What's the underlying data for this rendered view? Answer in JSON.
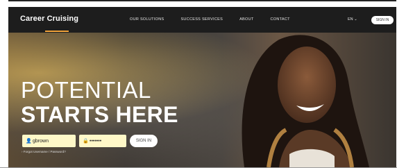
{
  "brand": {
    "name": "Career Cruising"
  },
  "nav": {
    "links": [
      "OUR SOLUTIONS",
      "SUCCESS SERVICES",
      "ABOUT",
      "CONTACT"
    ],
    "language": "EN",
    "signin_label": "SIGN IN"
  },
  "hero": {
    "line1": "POTENTIAL",
    "line2": "STARTS HERE"
  },
  "login": {
    "username_value": "gbrown",
    "password_value": "•••••••",
    "submit_label": "SIGN IN",
    "forgot_label": "Forgot Username / Password?"
  },
  "colors": {
    "accent": "#f2a33a",
    "field_bg": "#fff8c8"
  },
  "icons": {
    "user": "user-icon",
    "lock": "lock-icon",
    "caret": "chevron-down-icon",
    "forgot": "chevron-right-icon"
  }
}
